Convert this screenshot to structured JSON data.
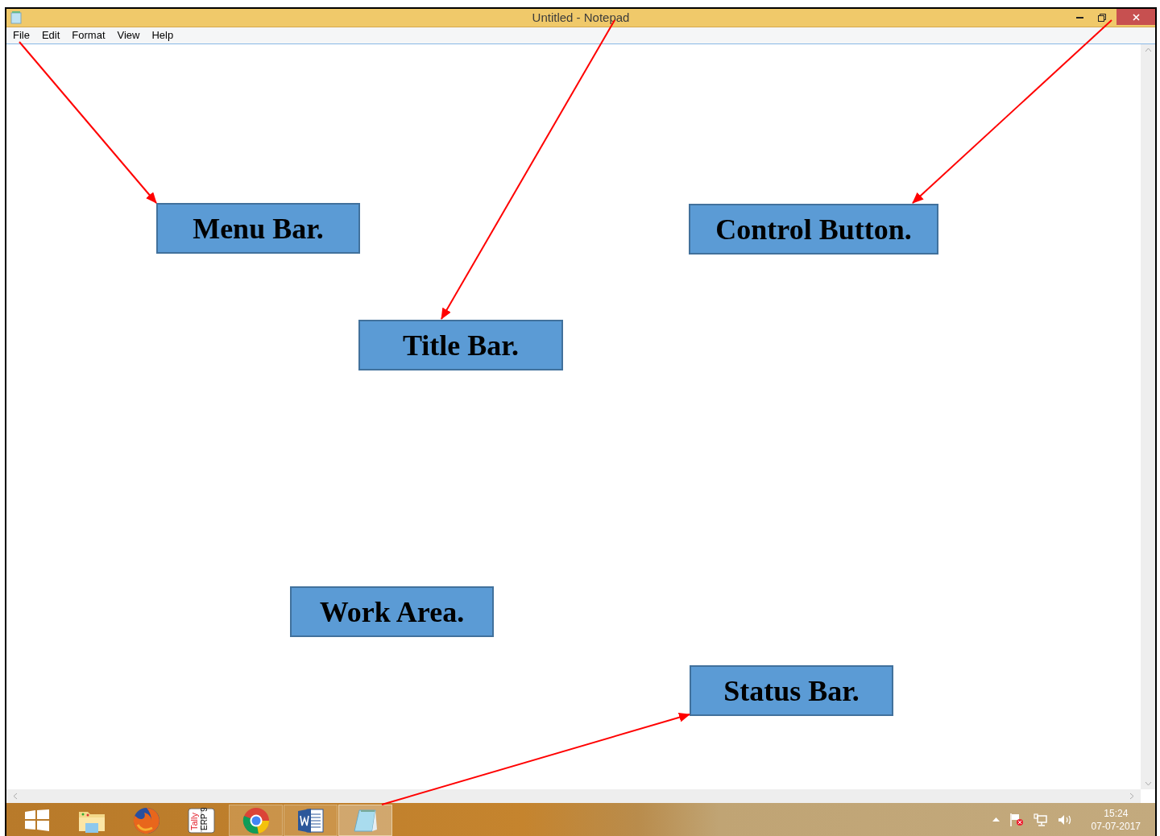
{
  "window": {
    "title": "Untitled - Notepad"
  },
  "menu": [
    {
      "label": "File"
    },
    {
      "label": "Edit"
    },
    {
      "label": "Format"
    },
    {
      "label": "View"
    },
    {
      "label": "Help"
    }
  ],
  "annotations": [
    {
      "label": "Menu Bar."
    },
    {
      "label": "Control Button."
    },
    {
      "label": "Title Bar."
    },
    {
      "label": "Work Area."
    },
    {
      "label": "Status Bar."
    }
  ],
  "taskbar": {
    "apps": [
      {
        "kind": "start",
        "running": false,
        "selected": false
      },
      {
        "kind": "explorer",
        "running": false,
        "selected": false
      },
      {
        "kind": "firefox",
        "running": false,
        "selected": false
      },
      {
        "kind": "tally",
        "running": false,
        "selected": false,
        "label_lines": [
          "Tally",
          "ERP 9"
        ]
      },
      {
        "kind": "chrome",
        "running": true,
        "selected": false
      },
      {
        "kind": "word",
        "running": true,
        "selected": false
      },
      {
        "kind": "notepad",
        "running": true,
        "selected": true
      }
    ],
    "clock": {
      "time": "15:24",
      "date": "07-07-2017"
    }
  }
}
